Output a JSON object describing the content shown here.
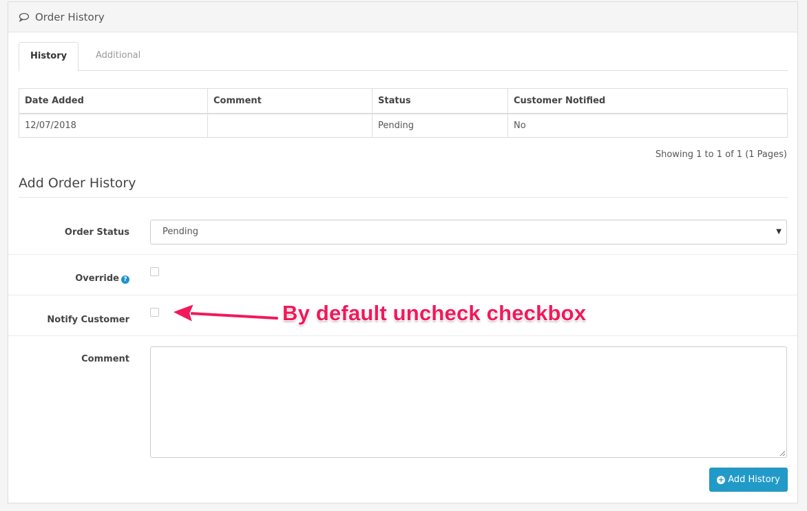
{
  "panel": {
    "title": "Order History"
  },
  "tabs": [
    {
      "label": "History",
      "active": true
    },
    {
      "label": "Additional",
      "active": false
    }
  ],
  "history_table": {
    "headers": [
      "Date Added",
      "Comment",
      "Status",
      "Customer Notified"
    ],
    "rows": [
      {
        "date_added": "12/07/2018",
        "comment": "",
        "status": "Pending",
        "customer_notified": "No"
      }
    ]
  },
  "pagination": {
    "text": "Showing 1 to 1 of 1 (1 Pages)"
  },
  "form": {
    "legend": "Add Order History",
    "order_status": {
      "label": "Order Status",
      "value": "Pending"
    },
    "override": {
      "label": "Override",
      "checked": false
    },
    "notify_customer": {
      "label": "Notify Customer",
      "checked": false
    },
    "comment": {
      "label": "Comment",
      "value": ""
    },
    "submit_label": "Add History"
  },
  "annotation": {
    "text": "By default uncheck checkbox",
    "color": "#f1195a"
  },
  "colors": {
    "primary": "#229ac8",
    "help": "#1e91cf"
  }
}
